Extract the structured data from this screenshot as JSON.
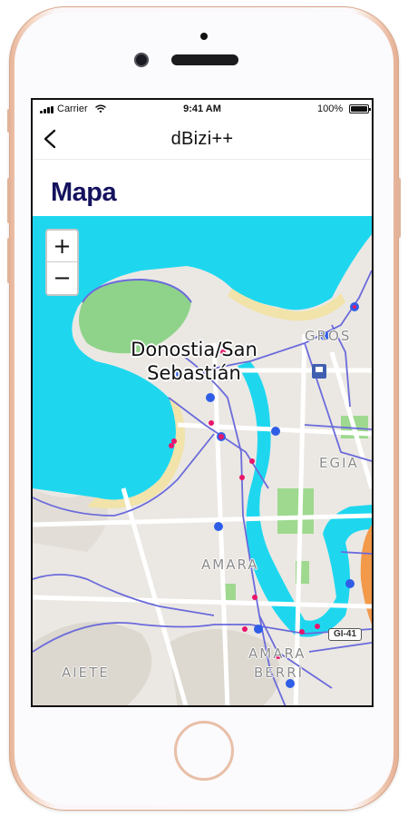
{
  "status_bar": {
    "carrier": "Carrier",
    "time": "9:41 AM",
    "battery": "100%"
  },
  "nav": {
    "title": "dBizi++",
    "back_icon": "chevron-left-icon"
  },
  "page": {
    "title": "Mapa"
  },
  "map": {
    "zoom_in": "+",
    "zoom_out": "−",
    "city_label_line1": "Donostia/San",
    "city_label_line2": "Sebastián",
    "districts": {
      "gros": "GROS",
      "egia": "EGIA",
      "amara": "AMARA",
      "amara_berri_1": "AMARA",
      "amara_berri_2": "BERRI",
      "aiete": "AIETE"
    },
    "road_shield": "GI-41",
    "colors": {
      "water": "#1ed7ef",
      "route": "#6b6bdb",
      "station_blue": "#2f5ee6",
      "station_pink": "#e8156b"
    }
  }
}
